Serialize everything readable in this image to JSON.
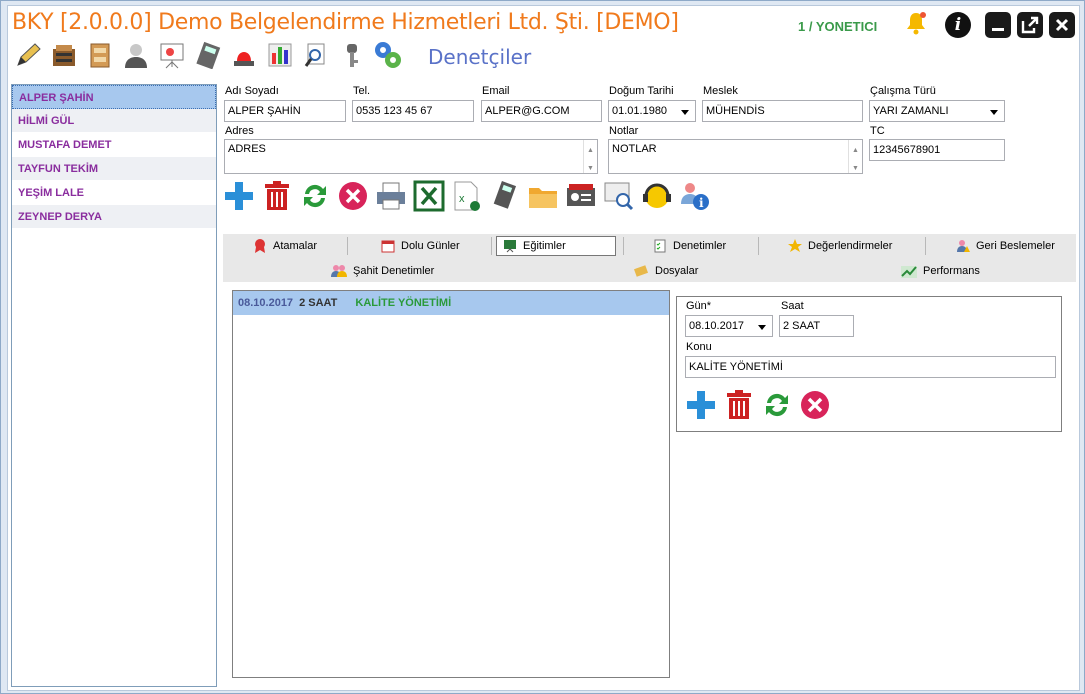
{
  "window": {
    "title": "BKY [2.0.0.0] Demo Belgelendirme Hizmetleri Ltd. Şti. [DEMO]",
    "user": "1 / YONETICI",
    "page_title": "Denetçiler",
    "accent_color": "#f07a1c"
  },
  "toolbar": {
    "icons": [
      "pen-icon",
      "cabinet-icon",
      "drawer-icon",
      "person-icon",
      "presentation-icon",
      "calculator-icon",
      "alarm-light-icon",
      "bar-chart-icon",
      "document-search-icon",
      "key-icon",
      "gears-icon"
    ]
  },
  "auditors": [
    "ALPER ŞAHİN",
    "HİLMİ GÜL",
    "MUSTAFA DEMET",
    "TAYFUN TEKİM",
    "YEŞİM LALE",
    "ZEYNEP DERYA"
  ],
  "form": {
    "name_label": "Adı Soyadı",
    "name_value": "ALPER ŞAHİN",
    "tel_label": "Tel.",
    "tel_value": "0535 123 45 67",
    "email_label": "Email",
    "email_value": "ALPER@G.COM",
    "birth_label": "Doğum Tarihi",
    "birth_value": "01.01.1980",
    "job_label": "Meslek",
    "job_value": "MÜHENDİS",
    "worktype_label": "Çalışma Türü",
    "worktype_value": "YARI ZAMANLI",
    "address_label": "Adres",
    "address_value": "ADRES",
    "notes_label": "Notlar",
    "notes_value": "NOTLAR",
    "tc_label": "TC",
    "tc_value": "12345678901"
  },
  "tabs": {
    "row1": [
      "Atamalar",
      "Dolu Günler",
      "Eğitimler",
      "Denetimler",
      "Değerlendirmeler",
      "Geri Beslemeler"
    ],
    "row2": [
      "Şahit Denetimler",
      "Dosyalar",
      "Performans"
    ],
    "active": "Eğitimler"
  },
  "trainings": [
    {
      "date": "08.10.2017",
      "duration": "2 SAAT",
      "topic": "KALİTE YÖNETİMİ"
    }
  ],
  "detail": {
    "day_label": "Gün*",
    "day_value": "08.10.2017",
    "time_label": "Saat",
    "time_value": "2 SAAT",
    "topic_label": "Konu",
    "topic_value": "KALİTE YÖNETİMİ"
  }
}
